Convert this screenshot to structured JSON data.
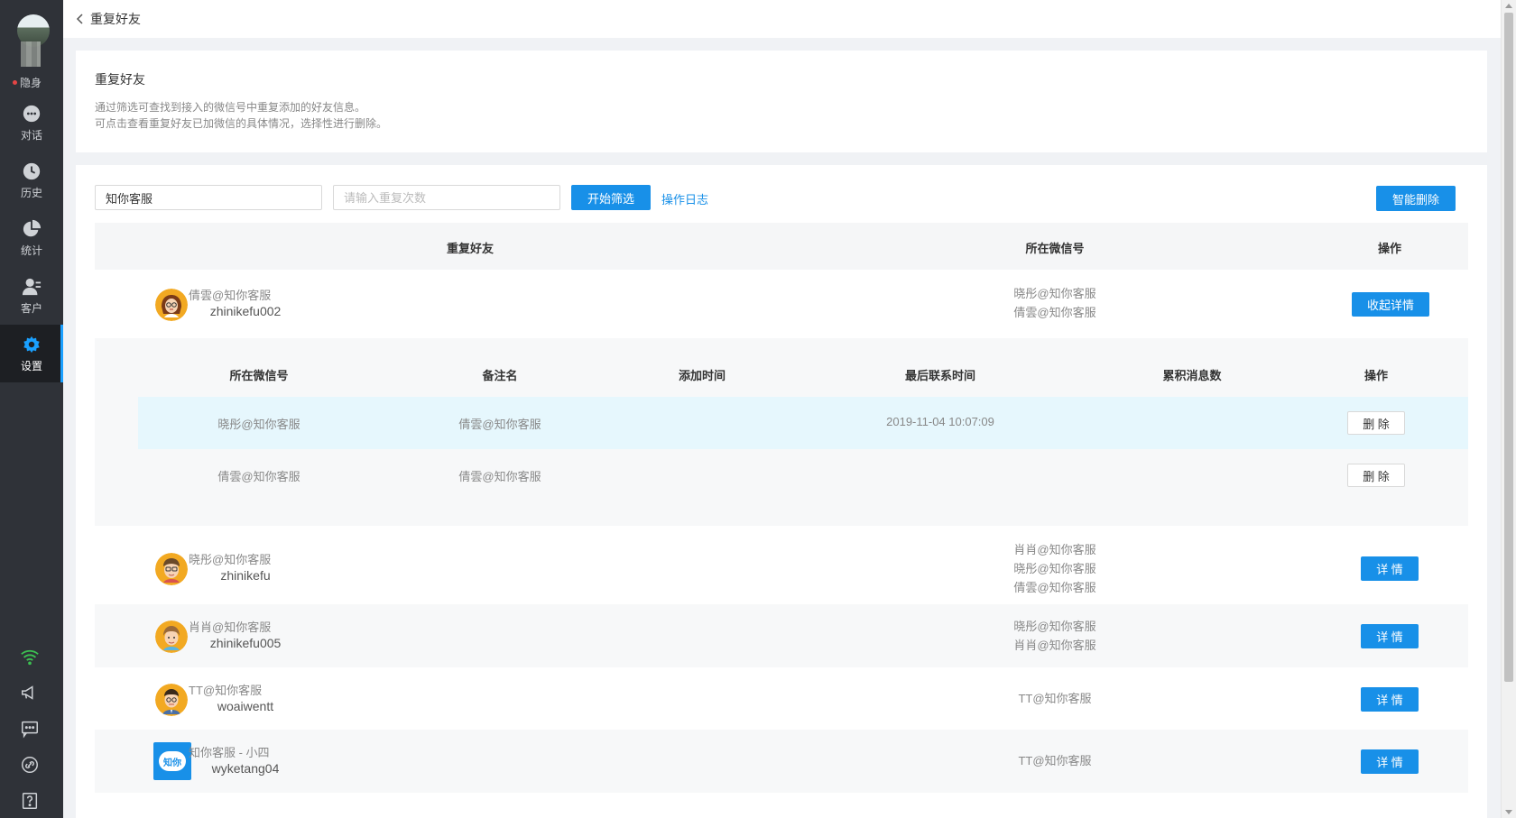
{
  "sidebar": {
    "status": "隐身",
    "nav": [
      {
        "label": "对话",
        "icon": "chat-icon"
      },
      {
        "label": "历史",
        "icon": "clock-icon"
      },
      {
        "label": "统计",
        "icon": "pie-chart-icon"
      },
      {
        "label": "客户",
        "icon": "customer-icon"
      },
      {
        "label": "设置",
        "icon": "gear-icon"
      }
    ],
    "tools": [
      "wifi-icon",
      "megaphone-icon",
      "message-icon",
      "link-icon",
      "help-icon"
    ]
  },
  "topbar": {
    "title": "重复好友"
  },
  "info": {
    "title": "重复好友",
    "line1": "通过筛选可查找到接入的微信号中重复添加的好友信息。",
    "line2": "可点击查看重复好友已加微信的具体情况，选择性进行删除。"
  },
  "filter": {
    "account_value": "知你客服",
    "count_placeholder": "请输入重复次数",
    "filter_button": "开始筛选",
    "log_link": "操作日志",
    "smart_delete": "智能删除"
  },
  "table": {
    "headers": {
      "friend": "重复好友",
      "wechat": "所在微信号",
      "action": "操作"
    },
    "rows": [
      {
        "name": "倩雲@知你客服",
        "id": "zhinikefu002",
        "wechats": [
          "晓彤@知你客服",
          "倩雲@知你客服"
        ],
        "action": "收起详情"
      },
      {
        "name": "晓彤@知你客服",
        "id": "zhinikefu",
        "wechats": [
          "肖肖@知你客服",
          "晓彤@知你客服",
          "倩雲@知你客服"
        ],
        "action": "详 情"
      },
      {
        "name": "肖肖@知你客服",
        "id": "zhinikefu005",
        "wechats": [
          "晓彤@知你客服",
          "肖肖@知你客服"
        ],
        "action": "详 情"
      },
      {
        "name": "TT@知你客服",
        "id": "woaiwentt",
        "wechats": [
          "TT@知你客服"
        ],
        "action": "详 情"
      },
      {
        "name": "知你客服 - 小四",
        "id": "wyketang04",
        "wechats": [
          "TT@知你客服"
        ],
        "action": "详 情"
      }
    ]
  },
  "detail": {
    "headers": {
      "wechat": "所在微信号",
      "remark": "备注名",
      "added": "添加时间",
      "last_contact": "最后联系时间",
      "messages": "累积消息数",
      "action": "操作"
    },
    "rows": [
      {
        "wechat": "晓彤@知你客服",
        "remark": "倩雲@知你客服",
        "added": "",
        "last_contact": "2019-11-04 10:07:09",
        "messages": "",
        "action": "删 除"
      },
      {
        "wechat": "倩雲@知你客服",
        "remark": "倩雲@知你客服",
        "added": "",
        "last_contact": "",
        "messages": "",
        "action": "删 除"
      }
    ]
  },
  "logo_text": "知你",
  "colors": {
    "accent": "#1890e8",
    "sidebar": "#2f3238",
    "highlight": "#e6f7fd"
  }
}
